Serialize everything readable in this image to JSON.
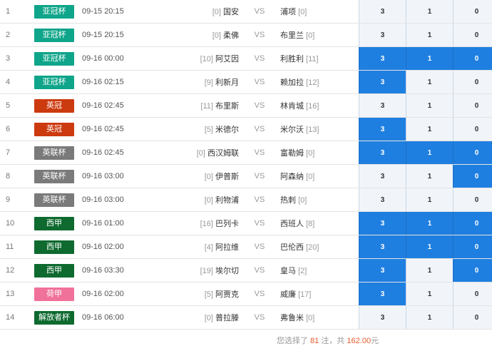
{
  "matches": [
    {
      "num": "1",
      "league": "亚冠杯",
      "league_color": "#0fa58a",
      "time": "09-15 20:15",
      "home_rank": "[0]",
      "home": "国安",
      "vs": "VS",
      "away": "浦项",
      "away_rank": "[0]",
      "opts": [
        "3",
        "1",
        "0"
      ],
      "sel": [
        false,
        false,
        false
      ]
    },
    {
      "num": "2",
      "league": "亚冠杯",
      "league_color": "#0fa58a",
      "time": "09-15 20:15",
      "home_rank": "[0]",
      "home": "柔佛",
      "vs": "VS",
      "away": "布里兰",
      "away_rank": "[0]",
      "opts": [
        "3",
        "1",
        "0"
      ],
      "sel": [
        false,
        false,
        false
      ]
    },
    {
      "num": "3",
      "league": "亚冠杯",
      "league_color": "#0fa58a",
      "time": "09-16 00:00",
      "home_rank": "[10]",
      "home": "阿艾因",
      "vs": "VS",
      "away": "利胜利",
      "away_rank": "[11]",
      "opts": [
        "3",
        "1",
        "0"
      ],
      "sel": [
        true,
        true,
        true
      ]
    },
    {
      "num": "4",
      "league": "亚冠杯",
      "league_color": "#0fa58a",
      "time": "09-16 02:15",
      "home_rank": "[9]",
      "home": "利新月",
      "vs": "VS",
      "away": "赖加拉",
      "away_rank": "[12]",
      "opts": [
        "3",
        "1",
        "0"
      ],
      "sel": [
        true,
        false,
        false
      ]
    },
    {
      "num": "5",
      "league": "英冠",
      "league_color": "#cc3a0f",
      "time": "09-16 02:45",
      "home_rank": "[11]",
      "home": "布里斯",
      "vs": "VS",
      "away": "林肯城",
      "away_rank": "[16]",
      "opts": [
        "3",
        "1",
        "0"
      ],
      "sel": [
        false,
        false,
        false
      ]
    },
    {
      "num": "6",
      "league": "英冠",
      "league_color": "#cc3a0f",
      "time": "09-16 02:45",
      "home_rank": "[5]",
      "home": "米德尔",
      "vs": "VS",
      "away": "米尔沃",
      "away_rank": "[13]",
      "opts": [
        "3",
        "1",
        "0"
      ],
      "sel": [
        true,
        false,
        false
      ]
    },
    {
      "num": "7",
      "league": "英联杯",
      "league_color": "#7a7a7a",
      "time": "09-16 02:45",
      "home_rank": "[0]",
      "home": "西汉姆联",
      "vs": "VS",
      "away": "富勒姆",
      "away_rank": "[0]",
      "opts": [
        "3",
        "1",
        "0"
      ],
      "sel": [
        true,
        true,
        true
      ]
    },
    {
      "num": "8",
      "league": "英联杯",
      "league_color": "#7a7a7a",
      "time": "09-16 03:00",
      "home_rank": "[0]",
      "home": "伊普斯",
      "vs": "VS",
      "away": "阿森纳",
      "away_rank": "[0]",
      "opts": [
        "3",
        "1",
        "0"
      ],
      "sel": [
        false,
        false,
        true
      ]
    },
    {
      "num": "9",
      "league": "英联杯",
      "league_color": "#7a7a7a",
      "time": "09-16 03:00",
      "home_rank": "[0]",
      "home": "利物浦",
      "vs": "VS",
      "away": "热刺",
      "away_rank": "[0]",
      "opts": [
        "3",
        "1",
        "0"
      ],
      "sel": [
        false,
        false,
        false
      ]
    },
    {
      "num": "10",
      "league": "西甲",
      "league_color": "#0e6a2f",
      "time": "09-16 01:00",
      "home_rank": "[16]",
      "home": "巴列卡",
      "vs": "VS",
      "away": "西班人",
      "away_rank": "[8]",
      "opts": [
        "3",
        "1",
        "0"
      ],
      "sel": [
        true,
        true,
        true
      ]
    },
    {
      "num": "11",
      "league": "西甲",
      "league_color": "#0e6a2f",
      "time": "09-16 02:00",
      "home_rank": "[4]",
      "home": "阿拉维",
      "vs": "VS",
      "away": "巴伦西",
      "away_rank": "[20]",
      "opts": [
        "3",
        "1",
        "0"
      ],
      "sel": [
        true,
        true,
        true
      ]
    },
    {
      "num": "12",
      "league": "西甲",
      "league_color": "#0e6a2f",
      "time": "09-16 03:30",
      "home_rank": "[19]",
      "home": "埃尔切",
      "vs": "VS",
      "away": "皇马",
      "away_rank": "[2]",
      "opts": [
        "3",
        "1",
        "0"
      ],
      "sel": [
        true,
        false,
        true
      ]
    },
    {
      "num": "13",
      "league": "荷甲",
      "league_color": "#f0719a",
      "time": "09-16 02:00",
      "home_rank": "[5]",
      "home": "阿贾克",
      "vs": "VS",
      "away": "威廉",
      "away_rank": "[17]",
      "opts": [
        "3",
        "1",
        "0"
      ],
      "sel": [
        true,
        false,
        false
      ]
    },
    {
      "num": "14",
      "league": "解放者杯",
      "league_color": "#0e6a2f",
      "time": "09-16 06:00",
      "home_rank": "[0]",
      "home": "普拉滕",
      "vs": "VS",
      "away": "弗鲁米",
      "away_rank": "[0]",
      "opts": [
        "3",
        "1",
        "0"
      ],
      "sel": [
        false,
        false,
        false
      ]
    }
  ],
  "summary": {
    "prefix": "您选择了",
    "count": "81",
    "mid": "注，共",
    "amount": "162.00",
    "suffix": "元"
  }
}
